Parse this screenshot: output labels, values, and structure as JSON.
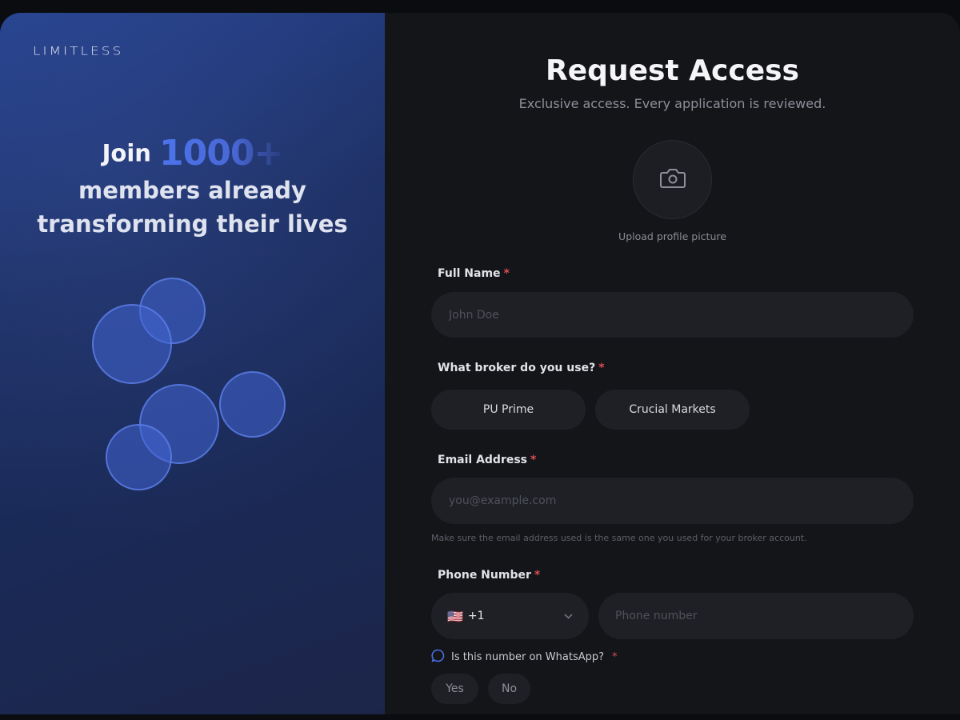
{
  "brand": {
    "logo_text": "LIMITLESS"
  },
  "hero": {
    "join": "Join",
    "count": "1000+",
    "line2": "members already",
    "line3": "transforming their lives"
  },
  "form": {
    "title": "Request Access",
    "subtitle": "Exclusive access. Every application is reviewed.",
    "avatar": {
      "icon": "camera-icon",
      "caption": "Upload profile picture"
    },
    "required_marker": "*",
    "full_name": {
      "label": "Full Name",
      "placeholder": "John Doe",
      "value": ""
    },
    "broker": {
      "label": "What broker do you use?",
      "options": [
        "PU Prime",
        "Crucial Markets"
      ]
    },
    "email": {
      "label": "Email Address",
      "placeholder": "you@example.com",
      "value": "",
      "hint": "Make sure the email address used is the same one you used for your broker account."
    },
    "phone": {
      "label": "Phone Number",
      "country_flag": "🇺🇸",
      "country_code": "+1",
      "placeholder": "Phone number",
      "value": ""
    },
    "whatsapp": {
      "question": "Is this number on WhatsApp?",
      "icon": "chat-bubble-icon",
      "options": [
        "Yes",
        "No"
      ]
    }
  },
  "colors": {
    "accent": "#4a6fe0",
    "required": "#d84d56",
    "panel_bg": "#141519",
    "input_bg": "#1f2025"
  }
}
